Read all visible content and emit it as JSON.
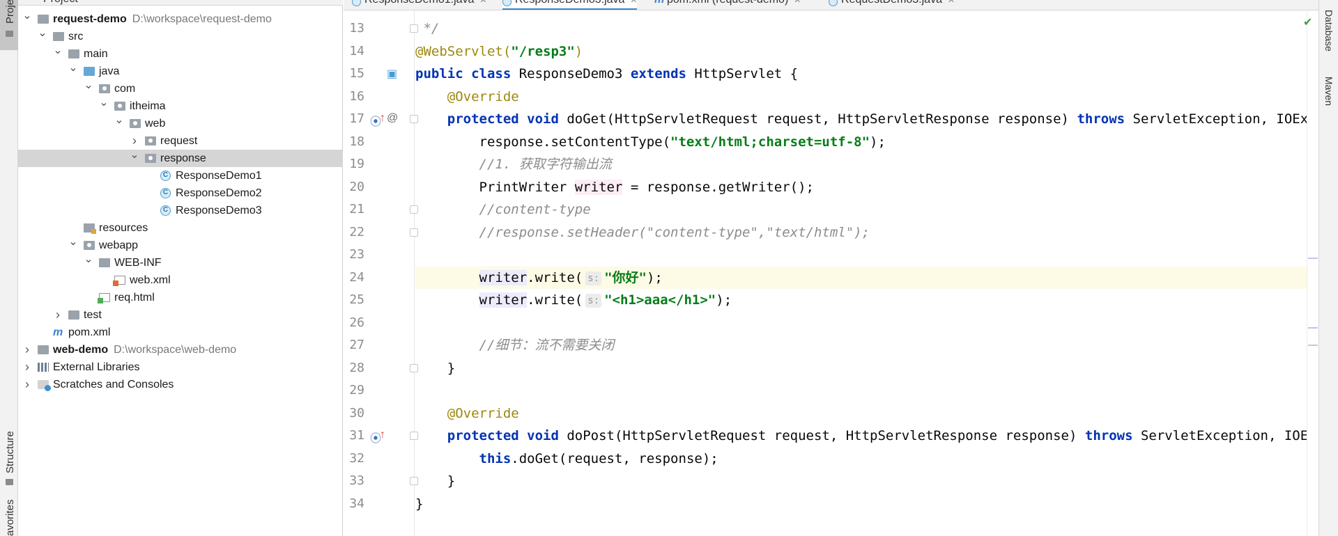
{
  "left_strip": {
    "project_tab": "Proje",
    "structure_tab": "Structure",
    "favorites_tab": "avorites"
  },
  "project_panel": {
    "title": "Project",
    "tree": [
      {
        "label": "request-demo",
        "path": "D:\\workspace\\request-demo",
        "bold": true,
        "indent": 0,
        "arrow": "down",
        "icon": "module-folder-icon"
      },
      {
        "label": "src",
        "indent": 1,
        "arrow": "down",
        "icon": "folder-icon"
      },
      {
        "label": "main",
        "indent": 2,
        "arrow": "down",
        "icon": "folder-icon"
      },
      {
        "label": "java",
        "indent": 3,
        "arrow": "down",
        "icon": "source-folder-icon"
      },
      {
        "label": "com",
        "indent": 4,
        "arrow": "down",
        "icon": "package-icon"
      },
      {
        "label": "itheima",
        "indent": 5,
        "arrow": "down",
        "icon": "package-icon"
      },
      {
        "label": "web",
        "indent": 6,
        "arrow": "down",
        "icon": "package-icon"
      },
      {
        "label": "request",
        "indent": 7,
        "arrow": "right",
        "icon": "package-icon"
      },
      {
        "label": "response",
        "indent": 7,
        "arrow": "down",
        "icon": "package-icon",
        "selected": true
      },
      {
        "label": "ResponseDemo1",
        "indent": 8,
        "arrow": "",
        "icon": "class-icon"
      },
      {
        "label": "ResponseDemo2",
        "indent": 8,
        "arrow": "",
        "icon": "class-icon"
      },
      {
        "label": "ResponseDemo3",
        "indent": 8,
        "arrow": "",
        "icon": "class-icon"
      },
      {
        "label": "resources",
        "indent": 3,
        "arrow": "",
        "icon": "resources-folder-icon"
      },
      {
        "label": "webapp",
        "indent": 3,
        "arrow": "down",
        "icon": "web-folder-icon"
      },
      {
        "label": "WEB-INF",
        "indent": 4,
        "arrow": "down",
        "icon": "folder-icon"
      },
      {
        "label": "web.xml",
        "indent": 5,
        "arrow": "",
        "icon": "xml-file-icon"
      },
      {
        "label": "req.html",
        "indent": 4,
        "arrow": "",
        "icon": "html-file-icon"
      },
      {
        "label": "test",
        "indent": 2,
        "arrow": "right",
        "icon": "folder-icon"
      },
      {
        "label": "pom.xml",
        "indent": 1,
        "arrow": "",
        "icon": "maven-icon"
      },
      {
        "label": "web-demo",
        "path": "D:\\workspace\\web-demo",
        "bold": true,
        "indent": 0,
        "arrow": "right",
        "icon": "module-folder-icon"
      },
      {
        "label": "External Libraries",
        "indent": 0,
        "arrow": "right",
        "icon": "libraries-icon"
      },
      {
        "label": "Scratches and Consoles",
        "indent": 0,
        "arrow": "right",
        "icon": "scratches-icon"
      }
    ]
  },
  "editor": {
    "tabs": [
      {
        "label": "ResponseDemo1.java",
        "icon": "class-icon",
        "active": false
      },
      {
        "label": "ResponseDemo3.java",
        "icon": "class-icon",
        "active": true
      },
      {
        "label": "pom.xml (request-demo)",
        "icon": "maven-icon",
        "active": false
      },
      {
        "label": "RequestDemo3.java",
        "icon": "class-icon",
        "active": false
      }
    ],
    "line_numbers": [
      "13",
      "14",
      "15",
      "16",
      "17",
      "18",
      "19",
      "20",
      "21",
      "22",
      "23",
      "24",
      "25",
      "26",
      "27",
      "28",
      "29",
      "30",
      "31",
      "32",
      "33",
      "34"
    ],
    "current_line": "24",
    "code": {
      "l13": " */",
      "l14_ann": "@WebServlet(",
      "l14_str": "\"/resp3\"",
      "l14_end": ")",
      "l15_kw1": "public class",
      "l15_rest": " ResponseDemo3 ",
      "l15_kw2": "extends",
      "l15_end": " HttpServlet {",
      "l16": "    @Override",
      "l17_kw1": "    protected void",
      "l17_mid": " doGet(HttpServletRequest request, HttpServletResponse response) ",
      "l17_kw2": "throws",
      "l17_end": " ServletException, IOException {",
      "l18_a": "        response.setContentType(",
      "l18_str": "\"text/html;charset=utf-8\"",
      "l18_end": ");",
      "l19_a": "        //1. ",
      "l19_cn": "获取字符输出流",
      "l20_a": "        PrintWriter ",
      "l20_var": "writer",
      "l20_end": " = response.getWriter();",
      "l21": "        //content-type",
      "l22": "        //response.setHeader(\"content-type\",\"text/html\");",
      "l24_var": "writer",
      "l24_call": ".write(",
      "l24_hint": "s:",
      "l24_str": "\"你好\"",
      "l24_end": ");",
      "l25_var": "writer",
      "l25_call": ".write(",
      "l25_hint": "s:",
      "l25_str": "\"<h1>aaa</h1>\"",
      "l25_end": ");",
      "l27_a": "        //",
      "l27_cn": "细节：流不需要关闭",
      "l28": "    }",
      "l30": "    @Override",
      "l31_kw1": "    protected void",
      "l31_mid": " doPost(HttpServletRequest request, HttpServletResponse response) ",
      "l31_kw2": "throws",
      "l31_end": " ServletException, IOException {",
      "l32_kw": "this",
      "l32_end": ".doGet(request, response);",
      "l33": "    }",
      "l34": "}"
    }
  },
  "right_strip": {
    "database_tab": "Database",
    "maven_tab": "Maven"
  },
  "colors": {
    "keyword": "#0033b3",
    "string": "#067d17",
    "annotation": "#9e880d",
    "comment": "#8c8c8c",
    "selection": "#d5d5d5",
    "current_line": "#fdfae6"
  }
}
